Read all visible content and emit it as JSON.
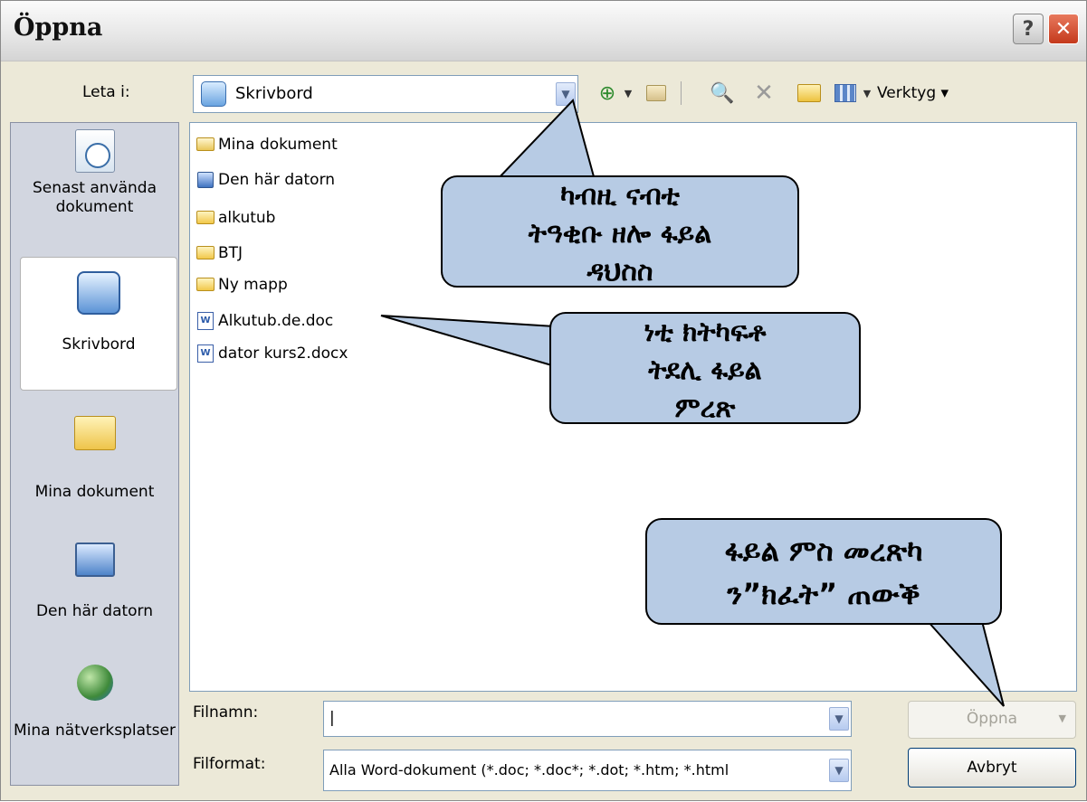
{
  "window": {
    "title": "Öppna",
    "help_symbol": "?",
    "close_symbol": "✕"
  },
  "toolbar": {
    "look_in_label": "Leta i:",
    "look_in_value": "Skrivbord",
    "tools_label": "Verktyg ▾",
    "icons": [
      "back-icon",
      "up-folder-icon",
      "search-web-icon",
      "delete-icon",
      "new-folder-icon",
      "views-icon"
    ]
  },
  "places": [
    {
      "label": "Senast använda dokument",
      "icon": "recent-documents-icon"
    },
    {
      "label": "Skrivbord",
      "icon": "desktop-icon",
      "selected": true
    },
    {
      "label": "Mina dokument",
      "icon": "my-documents-icon"
    },
    {
      "label": "Den här datorn",
      "icon": "my-computer-icon"
    },
    {
      "label": "Mina nätverksplatser",
      "icon": "network-places-icon"
    }
  ],
  "files": [
    {
      "name": "Mina dokument",
      "type": "special-folder"
    },
    {
      "name": "Den här datorn",
      "type": "computer"
    },
    {
      "name": "alkutub",
      "type": "folder"
    },
    {
      "name": "BTJ",
      "type": "folder"
    },
    {
      "name": "Ny mapp",
      "type": "folder"
    },
    {
      "name": "Alkutub.de.doc",
      "type": "word"
    },
    {
      "name": "dator kurs2.docx",
      "type": "word"
    }
  ],
  "filename": {
    "label": "Filnamn:",
    "value": "|"
  },
  "filetype": {
    "label": "Filformat:",
    "value": "Alla Word-dokument (*.doc; *.doc*; *.dot; *.htm; *.html"
  },
  "buttons": {
    "open": "Öppna",
    "cancel": "Avbryt"
  },
  "callouts": {
    "location": [
      "ካብዚ ናብቲ",
      "ትዓቂቡ ዘሎ ፋይል",
      "ዳህስስ"
    ],
    "select_file": [
      "ነቲ ክትካፍቶ",
      "ትደሊ ፋይል",
      "ምረጽ"
    ],
    "open_hint": [
      "ፋይል ምስ መረጽካ",
      "ን”ክፈት” ጠውቕ"
    ]
  },
  "colors": {
    "callout_fill": "#b7cbe4",
    "dialog_bg": "#ece9d8",
    "close_button": "#d44a2a"
  }
}
